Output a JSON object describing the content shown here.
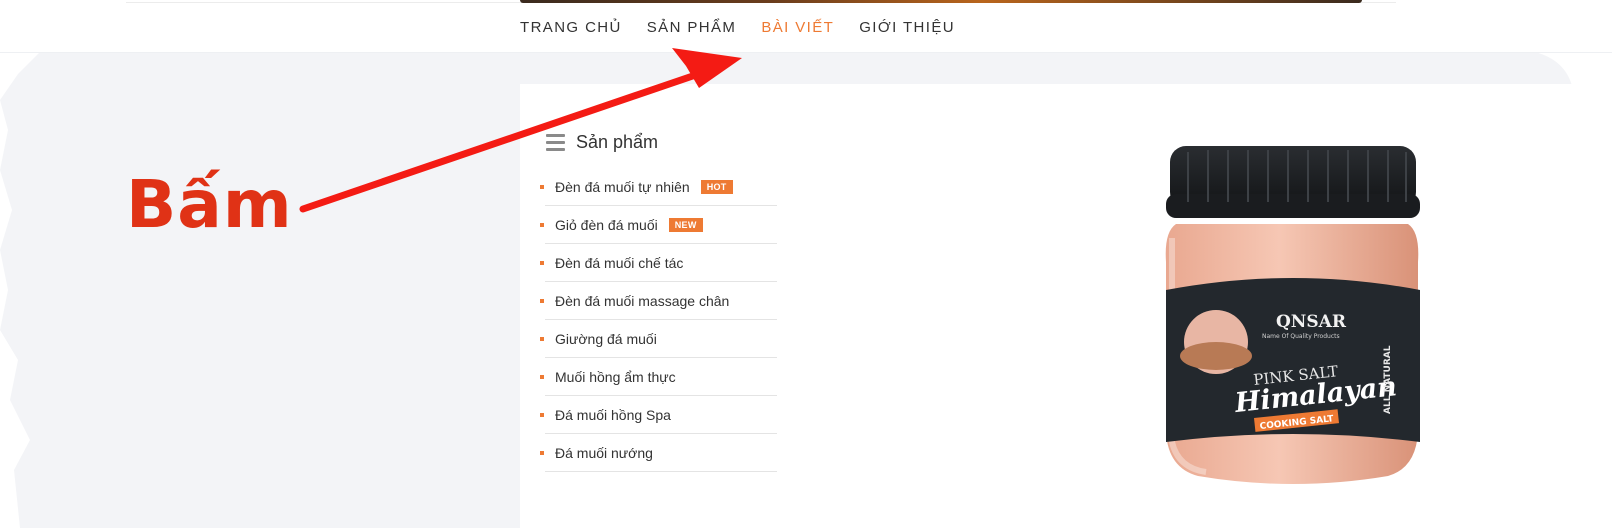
{
  "nav": {
    "items": [
      {
        "label": "TRANG CHỦ",
        "active": false
      },
      {
        "label": "SẢN PHẨM",
        "active": false
      },
      {
        "label": "BÀI VIẾT",
        "active": true
      },
      {
        "label": "GIỚI THIỆU",
        "active": false
      }
    ]
  },
  "sidebar": {
    "title": "Sản phẩm",
    "items": [
      {
        "label": "Đèn đá muối tự nhiên",
        "badge": "HOT"
      },
      {
        "label": "Giỏ đèn đá muối",
        "badge": "NEW"
      },
      {
        "label": "Đèn đá muối chế tác",
        "badge": ""
      },
      {
        "label": "Đèn đá muối massage chân",
        "badge": ""
      },
      {
        "label": "Giường đá muối",
        "badge": ""
      },
      {
        "label": "Muối hồng ẩm thực",
        "badge": ""
      },
      {
        "label": "Đá muối hồng Spa",
        "badge": ""
      },
      {
        "label": "Đá muối nướng",
        "badge": ""
      }
    ]
  },
  "product": {
    "brand": "QNSAR",
    "brand_tagline": "Name Of Quality Products",
    "line1": "PINK SALT",
    "line2": "Himalayan",
    "line3": "COOKING SALT",
    "side_text": "ALL NATURAL"
  },
  "annotation": {
    "label": "Bấm"
  },
  "colors": {
    "accent": "#ee7a33",
    "annotation": "#e03216",
    "panel": "#f3f4f7",
    "text": "#333333"
  }
}
